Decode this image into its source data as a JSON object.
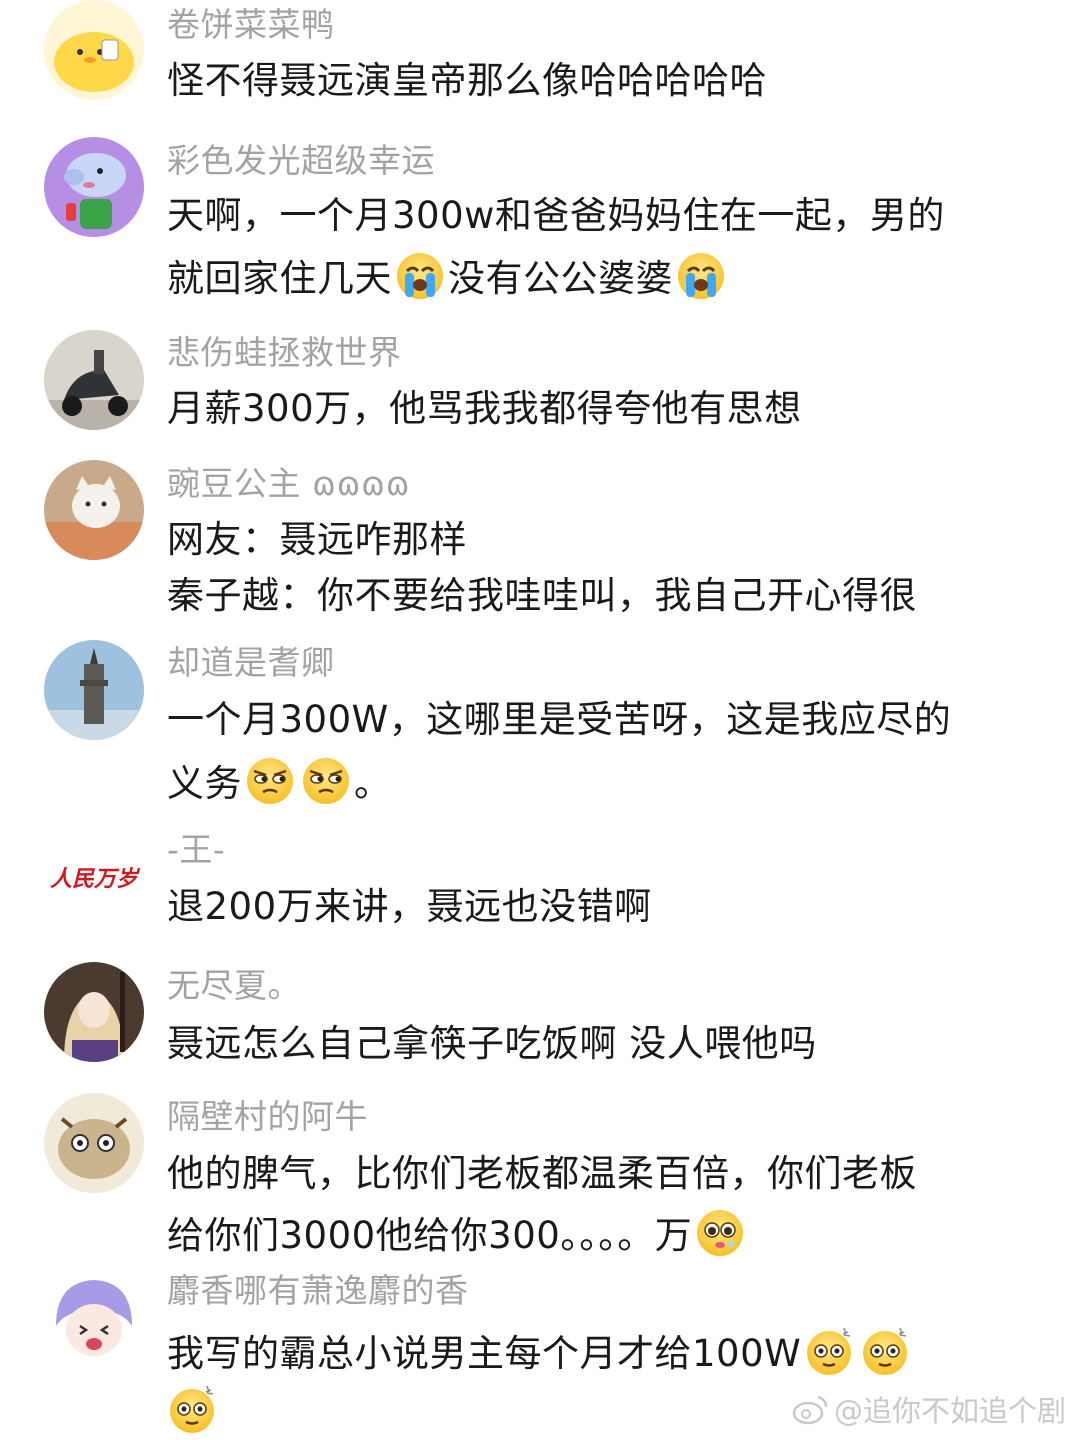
{
  "comments": [
    {
      "username": "卷饼菜菜鸭",
      "avatar": "yellow-chick-avatar",
      "lines": [
        {
          "text": "怪不得聂远演皇帝那么像哈哈哈哈哈"
        }
      ]
    },
    {
      "username": "彩色发光超级幸运",
      "avatar": "george-pig-avatar",
      "lines": [
        {
          "text": "天啊，一个月300w和爸爸妈妈住在一起，男的"
        },
        {
          "text_a": "就回家住几天",
          "text_b": "没有公公婆婆"
        }
      ]
    },
    {
      "username": "悲伤蛙拯救世界",
      "avatar": "scooter-photo-avatar",
      "lines": [
        {
          "text": "月薪300万，他骂我我都得夸他有思想"
        }
      ]
    },
    {
      "username": "豌豆公主 ɷɷɷɷ",
      "avatar": "white-cat-avatar",
      "lines": [
        {
          "text": "网友：聂远咋那样"
        },
        {
          "text": "秦子越：你不要给我哇哇叫，我自己开心得很"
        }
      ]
    },
    {
      "username": "却道是耆卿",
      "avatar": "tower-photo-avatar",
      "lines": [
        {
          "text": "一个月300W，这哪里是受苦呀，这是我应尽的"
        },
        {
          "text_a": "义务",
          "text_b": "。"
        }
      ]
    },
    {
      "username": "-王-",
      "avatar": "calligraphy-avatar",
      "avatar_text": "人民万岁",
      "lines": [
        {
          "text": "退200万来讲，聂远也没错啊"
        }
      ]
    },
    {
      "username": "无尽夏。",
      "avatar": "anime-girl-avatar",
      "lines": [
        {
          "text": "聂远怎么自己拿筷子吃饭啊 没人喂他吗"
        }
      ]
    },
    {
      "username": "隔壁村的阿牛",
      "avatar": "cartoon-creature-avatar",
      "lines": [
        {
          "text": "他的脾气，比你们老板都温柔百倍，你们老板"
        },
        {
          "text_a": "给你们3000他给你300。。。。万"
        }
      ]
    },
    {
      "username": "麝香哪有萧逸麝的香",
      "avatar": "anime-boy-avatar",
      "lines": [
        {
          "text_a": "我写的霸总小说男主每个月才给100W"
        }
      ]
    }
  ],
  "emoji_names": {
    "crying": "loudly-crying-emoji",
    "side_eye": "side-eye-emoji",
    "pleading": "pleading-emoji",
    "dizzy": "dizzy-face-emoji"
  },
  "watermark": {
    "text": "@追你不如追个剧",
    "icon": "weibo-logo-icon"
  },
  "colors": {
    "username": "#a3a3a3",
    "body_text": "#1a1a1a",
    "background": "#ffffff",
    "watermark": "#c9c9c9"
  }
}
